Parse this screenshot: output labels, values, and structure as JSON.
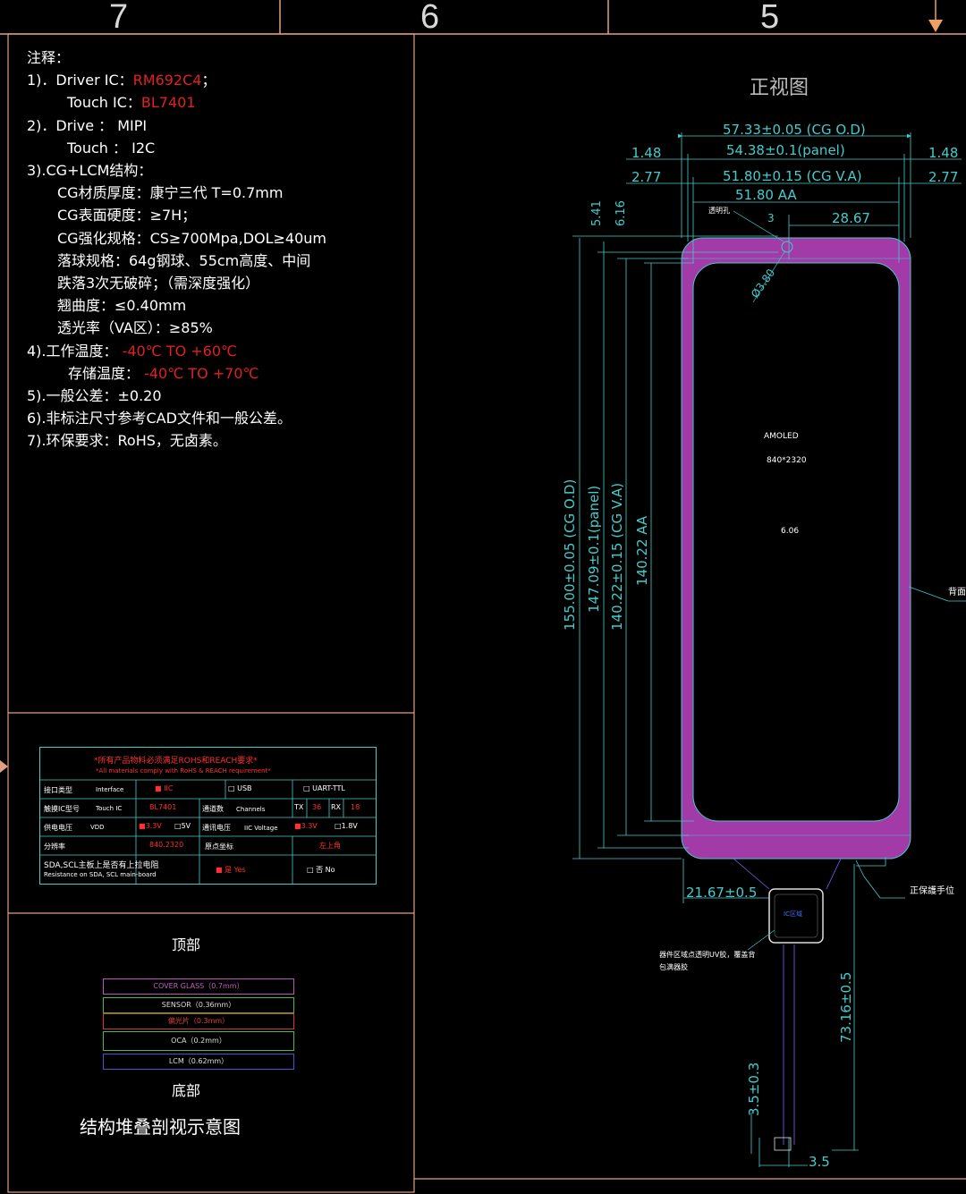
{
  "zones": [
    "7",
    "6",
    "5"
  ],
  "notes": {
    "heading": "注释：",
    "items": [
      {
        "prefix": "1)．Driver  IC：",
        "value": "RM692C4",
        "suffix": "；"
      },
      {
        "prefix": "Touch  IC：",
        "value": "BL7401",
        "suffix": ""
      },
      {
        "prefix": "2)．Drive  ：  MIPI",
        "value": "",
        "suffix": ""
      },
      {
        "prefix": "Touch  ：  I2C",
        "value": "",
        "suffix": ""
      },
      {
        "prefix": "3).CG+LCM结构：",
        "value": "",
        "suffix": ""
      },
      {
        "prefix": "CG材质厚度：康宁三代      T=0.7mm",
        "value": "",
        "suffix": ""
      },
      {
        "prefix": "CG表面硬度：≥7H；",
        "value": "",
        "suffix": ""
      },
      {
        "prefix": "CG强化规格：CS≥700Mpa,DOL≥40um",
        "value": "",
        "suffix": ""
      },
      {
        "prefix": "落球规格：64g钢球、55cm高度、中间",
        "value": "",
        "suffix": ""
      },
      {
        "prefix": "跌落3次无破碎；（需深度强化）",
        "value": "",
        "suffix": ""
      },
      {
        "prefix": "翘曲度：≤0.40mm",
        "value": "",
        "suffix": ""
      },
      {
        "prefix": "透光率（VA区）：≥85%",
        "value": "",
        "suffix": ""
      },
      {
        "prefix": "4).工作温度：",
        "value": " -40℃  TO  +60℃",
        "suffix": ""
      },
      {
        "prefix": "存储温度：",
        "value": " -40℃  TO  +70℃",
        "suffix": ""
      },
      {
        "prefix": "5).一般公差：±0.20",
        "value": "",
        "suffix": ""
      },
      {
        "prefix": "6).非标注尺寸参考CAD文件和一般公差。",
        "value": "",
        "suffix": ""
      },
      {
        "prefix": "7).环保要求：RoHS，无卤素。",
        "value": "",
        "suffix": ""
      }
    ]
  },
  "spec_table": {
    "header_cn": "*所有产品物料必须满足ROHS和REACH要求*",
    "header_en": "*All materials comply with RoHS & REACH requirement*",
    "rows": [
      {
        "label_cn": "接口类型",
        "label_en": "Interface",
        "opt1": "IIC",
        "opt2": "USB",
        "opt3": "UART-TTL"
      },
      {
        "label_cn": "触摸IC型号",
        "label_en": "Touch IC",
        "value": "BL7401",
        "label2_cn": "通道数",
        "label2_en": "Channels",
        "tx": "TX",
        "tx_val": "36",
        "rx": "RX",
        "rx_val": "18"
      },
      {
        "label_cn": "供电电压",
        "label_en": "VDD",
        "opt1": "3.3V",
        "opt2": "5V",
        "label2_cn": "通讯电压",
        "label2_en": "IIC Voltage",
        "opt3": "3.3V",
        "opt4": "1.8V"
      },
      {
        "label_cn": "分辨率",
        "label_en": "",
        "value": "840.2320",
        "label2_cn": "原点坐标",
        "value2": "左上角"
      },
      {
        "label_cn": "SDA,SCL主板上是否有上拉电阻",
        "label_en": "Resistance on SDA, SCL main-board",
        "opt1": "是 Yes",
        "opt2": "否 No"
      }
    ]
  },
  "stack": {
    "top_label": "顶部",
    "bottom_label": "底部",
    "caption": "结构堆叠剖视示意图",
    "layers": [
      {
        "name": "COVER GLASS（0.7mm）",
        "color": "#c050c0"
      },
      {
        "name": "SENSOR（0.36mm）",
        "color": "#40c040"
      },
      {
        "name": "偏光片（0.3mm）",
        "color": "#e03030"
      },
      {
        "name": "OCA（0.2mm）",
        "color": "#40c040"
      },
      {
        "name": "LCM（0.62mm）",
        "color": "#5050d0"
      }
    ]
  },
  "drawing": {
    "title": "正视图",
    "dims_h": [
      "57.33±0.05  (CG O.D)",
      "54.38±0.1(panel)",
      "51.80±0.15  (CG V.A)",
      "51.80   AA"
    ],
    "side_left": [
      "1.48",
      "2.77"
    ],
    "side_right": [
      "1.48",
      "2.77"
    ],
    "hole_label": "透明孔",
    "hole_dim": "3",
    "hole_offset": "28.67",
    "hole_dia": "Ø3.80",
    "top_small": [
      "5.41",
      "6.16"
    ],
    "dims_v": [
      "155.00±0.05  (CG O.D)",
      "147.09±0.1(panel)",
      "140.22±0.15  (CG V.A)",
      "140.22    AA"
    ],
    "amoled": "AMOLED",
    "resolution": "840*2320",
    "size": "6.06",
    "back_label": "背面",
    "fpc_width": "21.67±0.5",
    "hand_label": "正保護手位",
    "ic_label": "IC区域",
    "uv_note_1": "器件区域点透明UV胶，覆盖背",
    "uv_note_2": "包满器胶",
    "fpc_length": "73.16±0.5",
    "fpc_tail": "3.5±0.3",
    "fpc_bottom": "3.5"
  }
}
